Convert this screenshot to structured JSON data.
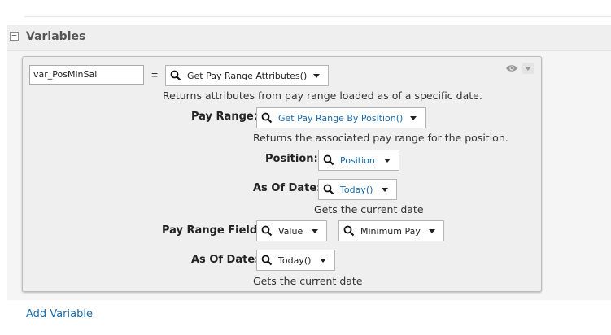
{
  "section": {
    "title": "Variables",
    "toggle_symbol": "−"
  },
  "variable": {
    "name_value": "var_PosMinSal",
    "equals": "=",
    "function": {
      "label": "Get Pay Range Attributes()",
      "description": "Returns attributes from pay range loaded as of a specific date."
    },
    "pay_range": {
      "label": "Pay Range:",
      "value": "Get Pay Range By Position()",
      "description": "Returns the associated pay range for the position.",
      "position": {
        "label": "Position:",
        "value": "Position"
      },
      "as_of_date": {
        "label": "As Of Date:",
        "value": "Today()",
        "description": "Gets the current date"
      }
    },
    "pay_range_field": {
      "label": "Pay Range Field:",
      "value": "Value",
      "sub_value": "Minimum Pay"
    },
    "as_of_date": {
      "label": "As Of Date:",
      "value": "Today()",
      "description": "Gets the current date"
    }
  },
  "add_variable_label": "Add Variable",
  "icons": {
    "eye": "eye-icon",
    "menu": "chevron-down-icon",
    "search": "search-icon",
    "dropdown": "caret-down-icon",
    "collapse": "collapse-toggle-icon"
  },
  "colors": {
    "link_blue": "#1a6aa8",
    "header_bg": "#efefef",
    "card_bg": "#efefef"
  }
}
